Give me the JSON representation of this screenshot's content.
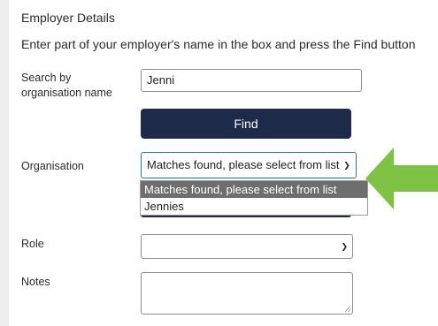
{
  "section": {
    "title": "Employer Details"
  },
  "instruction": "Enter part of your employer's name in the box and press the Find button",
  "search": {
    "label": "Search by organisation name",
    "value": "Jenni"
  },
  "find_button": {
    "label": "Find"
  },
  "organisation": {
    "label": "Organisation",
    "selected": "Matches found, please select from list",
    "options": [
      "Matches found, please select from list",
      "Jennies"
    ]
  },
  "role": {
    "label": "Role",
    "value": ""
  },
  "notes": {
    "label": "Notes",
    "value": ""
  },
  "icons": {
    "dropdown_arrow": "chevron-down-icon",
    "callout": "arrow-left-icon",
    "resize": "resize-grip-icon"
  },
  "colors": {
    "primary_button": "#1e2a4a",
    "select_focus": "#2d7a80",
    "option_highlight": "#6e6e6e",
    "callout_arrow": "#7dc242"
  }
}
